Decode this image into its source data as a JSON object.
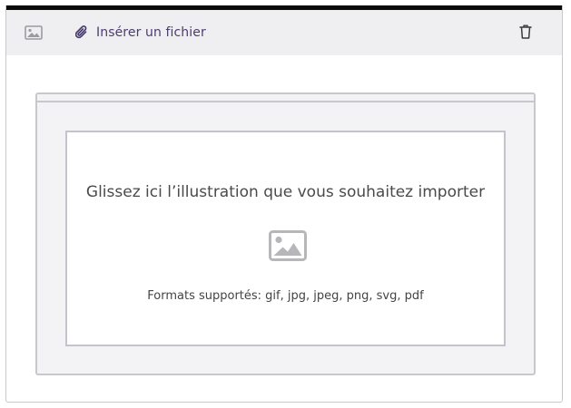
{
  "toolbar": {
    "image_icon": "image-icon",
    "insert_icon": "paperclip-icon",
    "insert_label": "Insérer un fichier",
    "delete_icon": "trash-icon"
  },
  "dropzone": {
    "title": "Glissez ici l’illustration que vous souhaitez importer",
    "icon": "image-icon",
    "formats": "Formats supportés: gif, jpg, jpeg, png, svg, pdf"
  },
  "colors": {
    "toolbar_bg": "#efeff2",
    "accent_text": "#4a3c6e",
    "border": "#c8c8cc",
    "top_bar": "#0a0a0a"
  }
}
